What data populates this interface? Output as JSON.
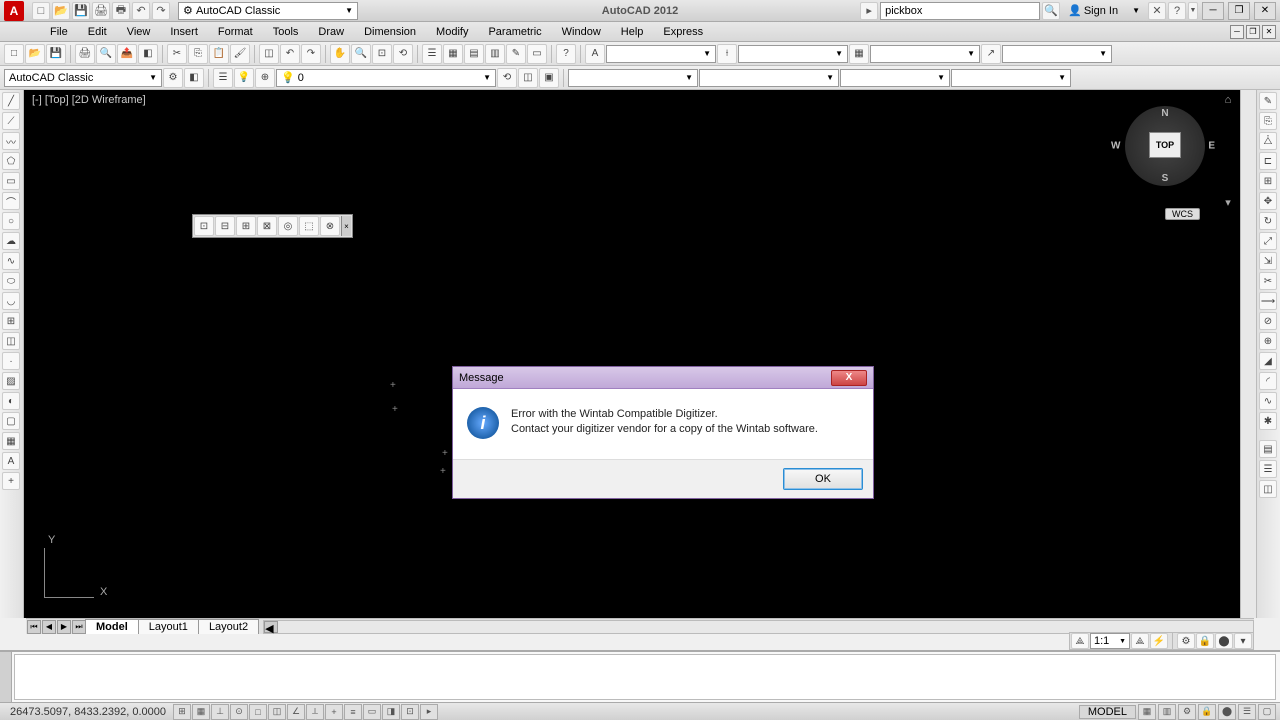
{
  "title": {
    "app": "AutoCAD 2012",
    "workspace": "AutoCAD Classic",
    "search": "pickbox",
    "signin": "Sign In"
  },
  "app_icon_letter": "A",
  "menu": [
    "File",
    "Edit",
    "View",
    "Insert",
    "Format",
    "Tools",
    "Draw",
    "Dimension",
    "Modify",
    "Parametric",
    "Window",
    "Help",
    "Express"
  ],
  "toolbar2": {
    "workspace": "AutoCAD Classic",
    "layer": "0"
  },
  "viewport": {
    "label": "[-] [Top] [2D Wireframe]",
    "viewcube_face": "TOP",
    "wcs": "WCS",
    "compass": {
      "n": "N",
      "s": "S",
      "e": "E",
      "w": "W"
    }
  },
  "ucs": {
    "x": "X",
    "y": "Y"
  },
  "dialog": {
    "title": "Message",
    "line1": "Error with the Wintab Compatible Digitizer.",
    "line2": "Contact your digitizer vendor for a copy of the Wintab software.",
    "ok": "OK",
    "icon_letter": "i"
  },
  "layout": {
    "tabs": [
      "Model",
      "Layout1",
      "Layout2"
    ],
    "active": 0
  },
  "view_tb": {
    "scale": "1:1"
  },
  "status": {
    "coords": "26473.5097, 8433.2392, 0.0000",
    "model": "MODEL"
  }
}
